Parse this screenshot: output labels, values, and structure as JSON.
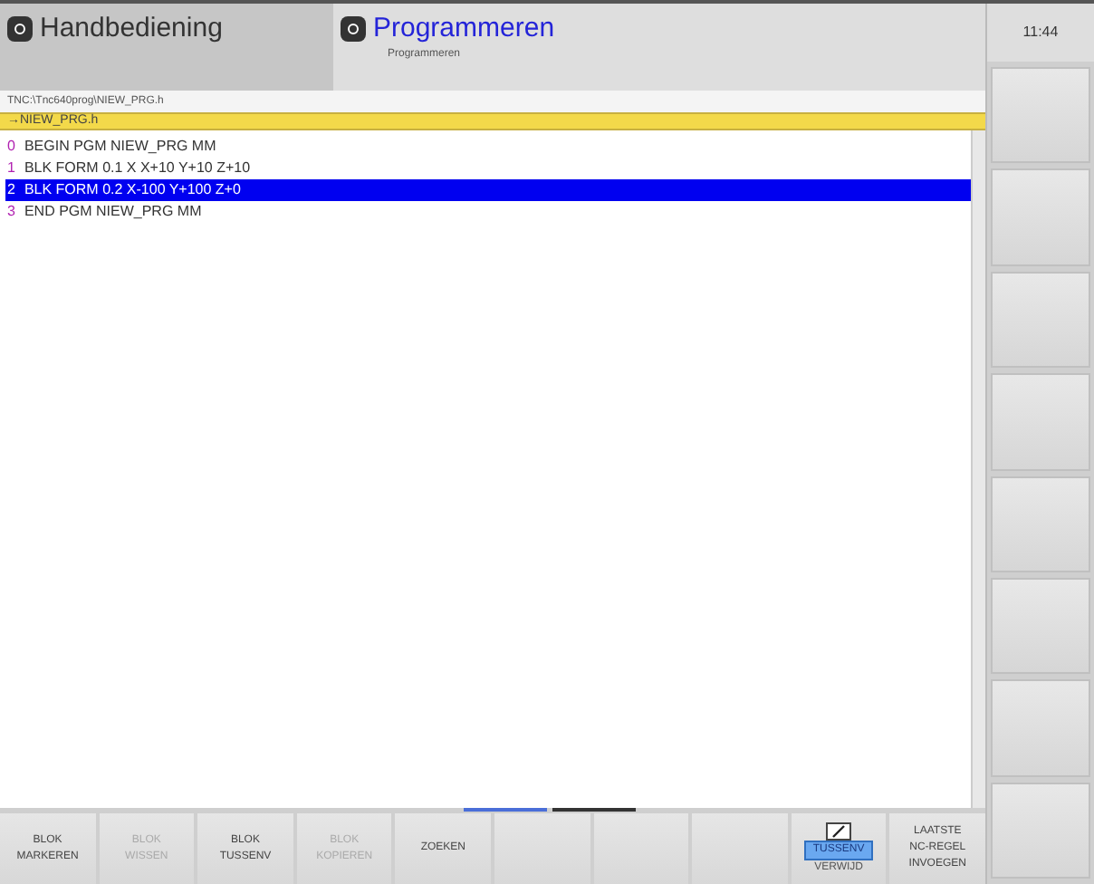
{
  "mode_tabs": [
    {
      "label": "Handbediening",
      "selected": false
    },
    {
      "label": "Programmeren",
      "selected": true,
      "sublabel": "Programmeren"
    }
  ],
  "clock": "11:44",
  "path": "TNC:\\Tnc640prog\\NIEW_PRG.h",
  "file_header": "→NIEW_PRG.h",
  "program_lines": [
    {
      "number": "0",
      "text": "BEGIN PGM NIEW_PRG MM",
      "selected": false
    },
    {
      "number": "1",
      "text": "BLK FORM 0.1 X  X+10  Y+10  Z+10",
      "selected": false
    },
    {
      "number": "2",
      "text": "BLK FORM 0.2 X-100  Y+100  Z+0",
      "selected": true
    },
    {
      "number": "3",
      "text": "END PGM NIEW_PRG MM",
      "selected": false
    }
  ],
  "softkeys": [
    {
      "kind": "text",
      "lines": [
        "BLOK",
        "MARKEREN"
      ],
      "disabled": false
    },
    {
      "kind": "text",
      "lines": [
        "BLOK",
        "WISSEN"
      ],
      "disabled": true
    },
    {
      "kind": "text",
      "lines": [
        "BLOK",
        "TUSSENV"
      ],
      "disabled": false
    },
    {
      "kind": "text",
      "lines": [
        "BLOK",
        "KOPIEREN"
      ],
      "disabled": true
    },
    {
      "kind": "text",
      "lines": [
        "ZOEKEN"
      ],
      "disabled": false
    },
    {
      "kind": "empty"
    },
    {
      "kind": "empty"
    },
    {
      "kind": "empty"
    },
    {
      "kind": "toggle",
      "options": [
        {
          "label": "TUSSENV",
          "selected": true
        },
        {
          "label": "VERWIJD",
          "selected": false
        }
      ]
    },
    {
      "kind": "text",
      "lines": [
        "LAATSTE",
        "NC-REGEL",
        "INVOEGEN"
      ],
      "disabled": false
    }
  ],
  "side_softkeys": [
    {
      "kind": "empty"
    },
    {
      "kind": "empty"
    },
    {
      "kind": "empty"
    },
    {
      "kind": "empty"
    },
    {
      "kind": "empty"
    },
    {
      "kind": "empty"
    },
    {
      "kind": "empty"
    },
    {
      "kind": "empty"
    }
  ]
}
